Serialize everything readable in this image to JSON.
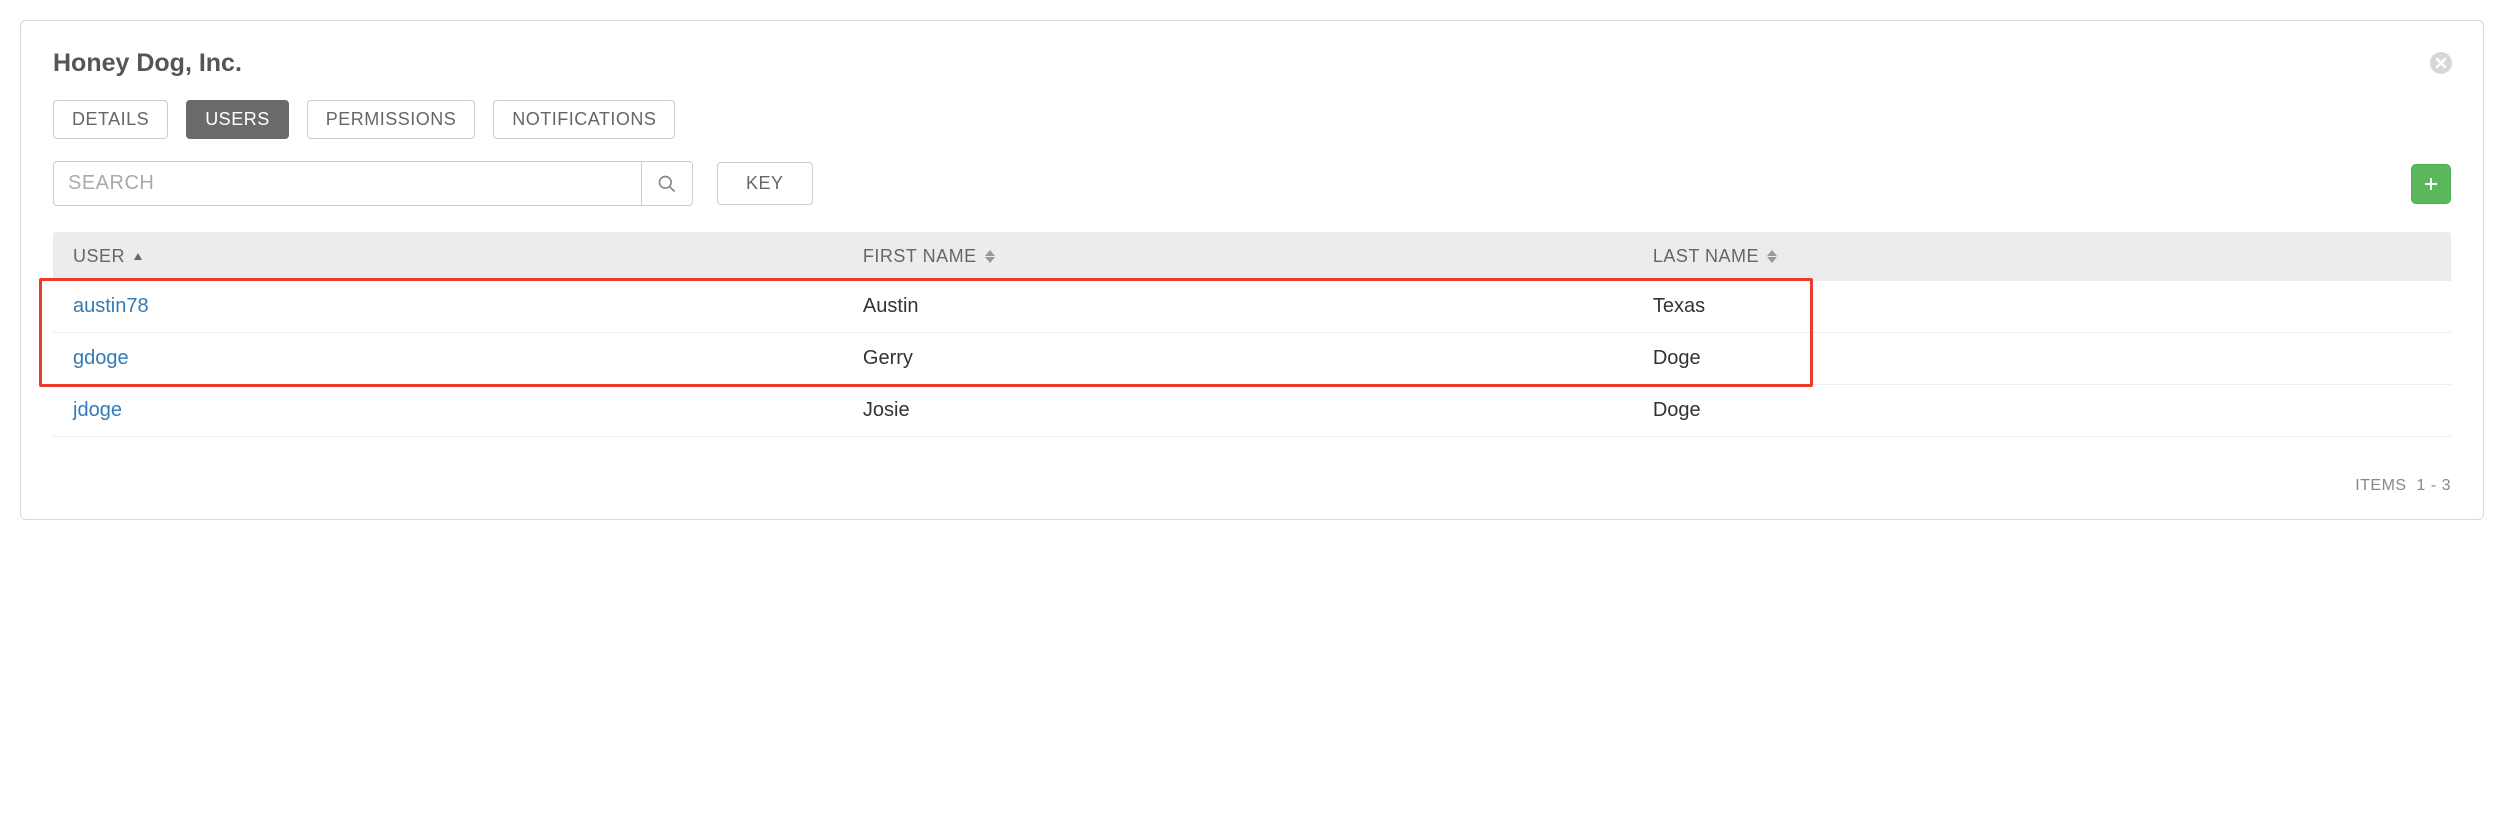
{
  "header": {
    "title": "Honey Dog, Inc."
  },
  "tabs": [
    {
      "label": "DETAILS",
      "active": false
    },
    {
      "label": "USERS",
      "active": true
    },
    {
      "label": "PERMISSIONS",
      "active": false
    },
    {
      "label": "NOTIFICATIONS",
      "active": false
    }
  ],
  "toolbar": {
    "search_placeholder": "SEARCH",
    "key_label": "KEY"
  },
  "table": {
    "columns": {
      "user": "USER",
      "first": "FIRST NAME",
      "last": "LAST NAME"
    },
    "rows": [
      {
        "user": "austin78",
        "first": "Austin",
        "last": "Texas"
      },
      {
        "user": "gdoge",
        "first": "Gerry",
        "last": "Doge"
      },
      {
        "user": "jdoge",
        "first": "Josie",
        "last": "Doge"
      }
    ]
  },
  "footer": {
    "items_label": "ITEMS",
    "range": "1 - 3"
  }
}
